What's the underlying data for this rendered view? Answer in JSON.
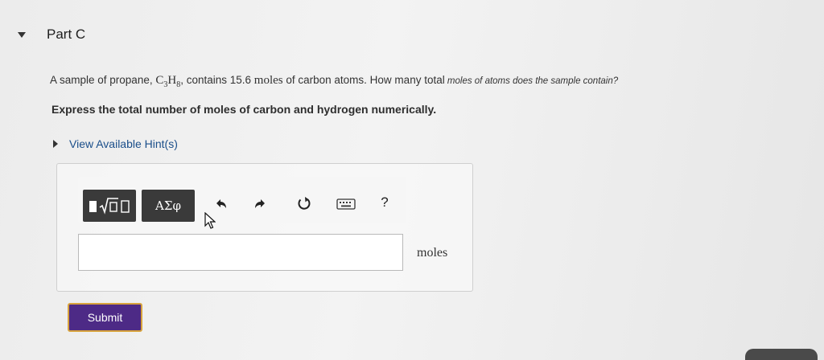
{
  "part": {
    "title": "Part C"
  },
  "question": {
    "prefix": "A sample of propane,",
    "formula_c": "C",
    "formula_c_sub": "3",
    "formula_h": "H",
    "formula_h_sub": "8",
    "middle": ", contains 15.6 ",
    "moles_word": "moles",
    "suffix": " of carbon atoms. How many total",
    "tail": " moles of atoms does the sample contain?"
  },
  "instruction": "Express the total number of moles of carbon and hydrogen numerically.",
  "hints": {
    "label": "View Available Hint(s)"
  },
  "toolbar": {
    "greek_label": "ΑΣφ",
    "help_label": "?"
  },
  "answer": {
    "value": "",
    "unit": "moles"
  },
  "submit": {
    "label": "Submit"
  }
}
